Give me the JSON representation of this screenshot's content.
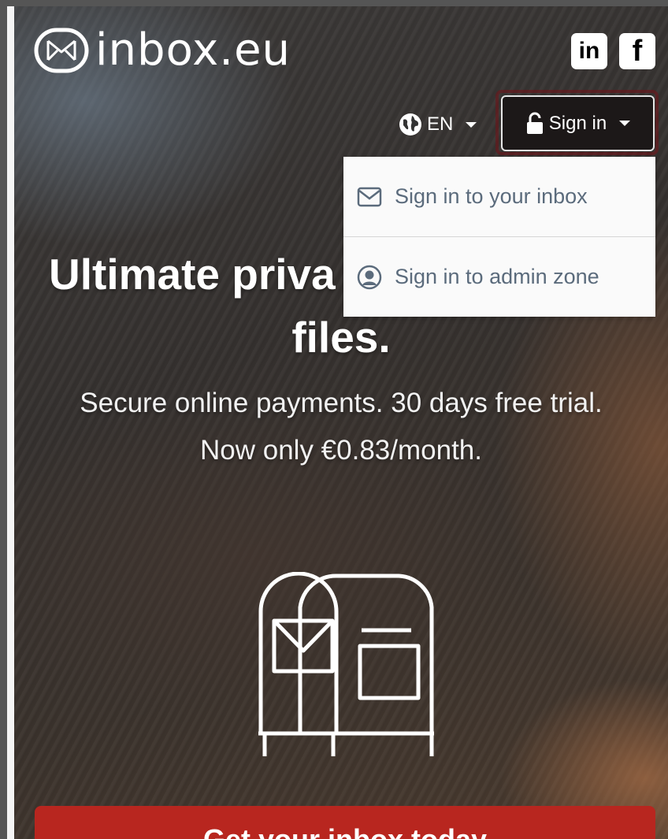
{
  "header": {
    "logo_text": "inbox.eu",
    "social": {
      "linkedin_label": "in",
      "facebook_label": "f"
    },
    "language": {
      "label": "EN"
    },
    "signin": {
      "label": "Sign in",
      "menu": [
        {
          "label": "Sign in to your inbox",
          "icon": "envelope-icon"
        },
        {
          "label": "Sign in to admin zone",
          "icon": "user-circle-icon"
        }
      ]
    }
  },
  "hero": {
    "title_line1": "Ultimate priva",
    "title_line2": "files.",
    "subtitle_line1": "Secure online payments. 30 days free trial.",
    "subtitle_line2": "Now only €0.83/month."
  },
  "cta": {
    "label": "Get your inbox today"
  },
  "colors": {
    "cta": "#b8261f",
    "dropdown_text": "#5b6b7c",
    "signin_bg": "#1c1818"
  }
}
